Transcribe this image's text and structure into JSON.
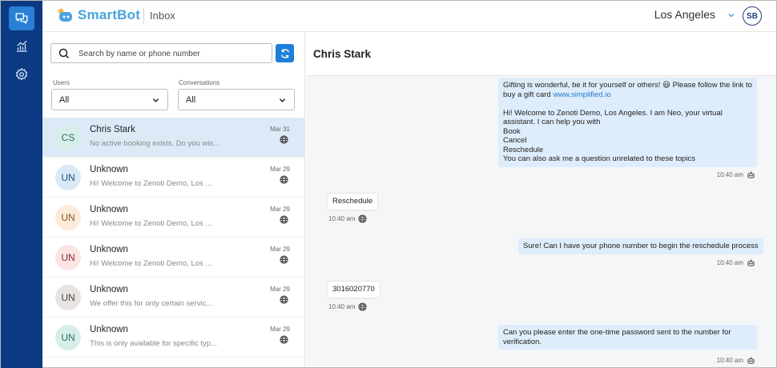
{
  "app": {
    "brand": "SmartBot",
    "page_title": "Inbox"
  },
  "header": {
    "location": "Los Angeles",
    "user_initials": "SB"
  },
  "search": {
    "placeholder": "Search by name or phone number",
    "value": ""
  },
  "filters": {
    "users": {
      "label": "Users",
      "value": "All"
    },
    "conversations": {
      "label": "Conversations",
      "value": "All"
    }
  },
  "conversations": [
    {
      "initials": "CS",
      "name": "Chris Stark",
      "preview": "No active booking exists, Do you wis...",
      "date": "Mar 31",
      "avatar_bg": "#d8efe9",
      "avatar_fg": "#2a6f64",
      "selected": true
    },
    {
      "initials": "UN",
      "name": "Unknown",
      "preview": "Hi! Welcome to Zenoti Demo, Los ...",
      "date": "Mar 29",
      "avatar_bg": "#dbe9f6",
      "avatar_fg": "#1d4e86"
    },
    {
      "initials": "UN",
      "name": "Unknown",
      "preview": "Hi! Welcome to Zenoti Demo, Los ...",
      "date": "Mar 29",
      "avatar_bg": "#fdebd9",
      "avatar_fg": "#8a5420"
    },
    {
      "initials": "UN",
      "name": "Unknown",
      "preview": "Hi! Welcome to Zenoti Demo, Los ...",
      "date": "Mar 29",
      "avatar_bg": "#fbe4e4",
      "avatar_fg": "#8a2e2e"
    },
    {
      "initials": "UN",
      "name": "Unknown",
      "preview": "We offer this for only certain servic...",
      "date": "Mar 29",
      "avatar_bg": "#e8e4e2",
      "avatar_fg": "#4e4440"
    },
    {
      "initials": "UN",
      "name": "Unknown",
      "preview": "This is only available for specific typ...",
      "date": "Mar 29",
      "avatar_bg": "#d8efe9",
      "avatar_fg": "#2a6f64"
    }
  ],
  "chat": {
    "contact_name": "Chris Stark",
    "messages": [
      {
        "from": "bot",
        "text_before": "Gifting is wonderful, be it for yourself or others! 😃 Please follow the link to buy a gift card ",
        "link": "www.simplified.io",
        "text_after": "\n\nHi! Welcome to Zenoti Demo, Los Angeles. I am Neo, your virtual assistant. I can help you with\nBook\nCancel\nReschedule\nYou can also ask me a question unrelated to these topics",
        "time": "10:40 am"
      },
      {
        "from": "user",
        "text": "Reschedule",
        "time": "10:40 am"
      },
      {
        "from": "bot",
        "text": "Sure! Can I have your phone number to begin the reschedule process",
        "time": "10:40 am"
      },
      {
        "from": "user",
        "text": "3016020770",
        "time": "10:40 am"
      },
      {
        "from": "bot",
        "text": "Can you please enter the one-time password sent to the number for verification.",
        "time": "10:40 am"
      }
    ]
  },
  "colors": {
    "rail": "#0b3a82",
    "accent": "#1f7fd8",
    "selected_row": "#dceaf7",
    "bot_bubble": "#deedfb"
  }
}
